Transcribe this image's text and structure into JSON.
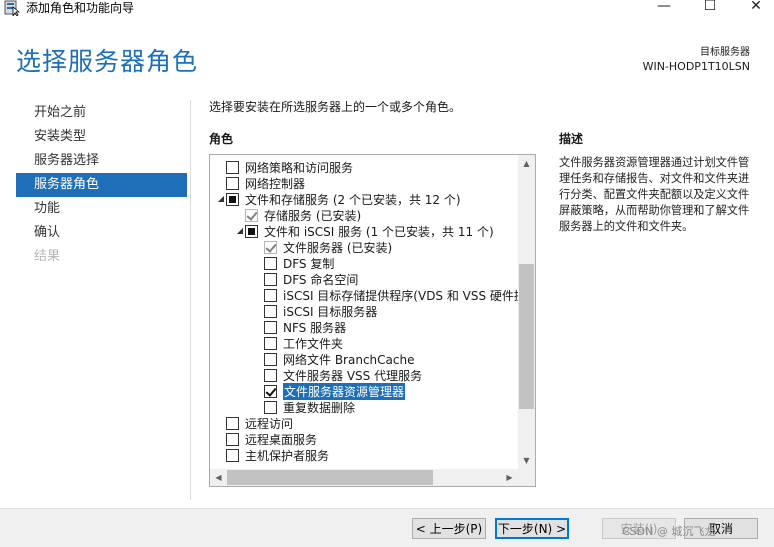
{
  "window": {
    "title": "添加角色和功能向导",
    "controls": {
      "minimize": "—",
      "maximize": "☐",
      "close": "✕"
    }
  },
  "header": {
    "page_title": "选择服务器角色",
    "target_label": "目标服务器",
    "target_server": "WIN-HODP1T10LSN"
  },
  "nav": {
    "items": [
      {
        "label": "开始之前",
        "state": "normal"
      },
      {
        "label": "安装类型",
        "state": "normal"
      },
      {
        "label": "服务器选择",
        "state": "normal"
      },
      {
        "label": "服务器角色",
        "state": "active"
      },
      {
        "label": "功能",
        "state": "normal"
      },
      {
        "label": "确认",
        "state": "normal"
      },
      {
        "label": "结果",
        "state": "disabled"
      }
    ]
  },
  "main": {
    "instruction": "选择要安装在所选服务器上的一个或多个角色。",
    "roles_heading": "角色",
    "description_heading": "描述",
    "description": "文件服务器资源管理器通过计划文件管理任务和存储报告、对文件和文件夹进行分类、配置文件夹配额以及定义文件屏蔽策略，从而帮助你管理和了解文件服务器上的文件和文件夹。"
  },
  "tree": {
    "scroll_position": 0.68,
    "rows": [
      {
        "label": "网络策略和访问服务",
        "level": 0,
        "state": "unchecked"
      },
      {
        "label": "网络控制器",
        "level": 0,
        "state": "unchecked"
      },
      {
        "label": "文件和存储服务 (2 个已安装，共 12 个)",
        "level": 0,
        "state": "indeterminate",
        "expander": "expanded"
      },
      {
        "label": "存储服务 (已安装)",
        "level": 1,
        "state": "checked_disabled"
      },
      {
        "label": "文件和 iSCSI 服务 (1 个已安装，共 11 个)",
        "level": 1,
        "state": "indeterminate",
        "expander": "expanded"
      },
      {
        "label": "文件服务器 (已安装)",
        "level": 2,
        "state": "checked_disabled"
      },
      {
        "label": "DFS 复制",
        "level": 2,
        "state": "unchecked"
      },
      {
        "label": "DFS 命名空间",
        "level": 2,
        "state": "unchecked"
      },
      {
        "label": "iSCSI 目标存储提供程序(VDS 和 VSS 硬件提",
        "level": 2,
        "state": "unchecked"
      },
      {
        "label": "iSCSI 目标服务器",
        "level": 2,
        "state": "unchecked"
      },
      {
        "label": "NFS 服务器",
        "level": 2,
        "state": "unchecked"
      },
      {
        "label": "工作文件夹",
        "level": 2,
        "state": "unchecked"
      },
      {
        "label": "网络文件 BranchCache",
        "level": 2,
        "state": "unchecked"
      },
      {
        "label": "文件服务器 VSS 代理服务",
        "level": 2,
        "state": "unchecked"
      },
      {
        "label": "文件服务器资源管理器",
        "level": 2,
        "state": "checked",
        "selected": true
      },
      {
        "label": "重复数据删除",
        "level": 2,
        "state": "unchecked"
      },
      {
        "label": "远程访问",
        "level": 0,
        "state": "unchecked"
      },
      {
        "label": "远程桌面服务",
        "level": 0,
        "state": "unchecked"
      },
      {
        "label": "主机保护者服务",
        "level": 0,
        "state": "unchecked"
      }
    ]
  },
  "footer": {
    "prev": "< 上一步(P)",
    "next": "下一步(N) >",
    "install": "安装(I)",
    "cancel": "取消",
    "watermark": "CSDN @ 城沉飞龙"
  }
}
